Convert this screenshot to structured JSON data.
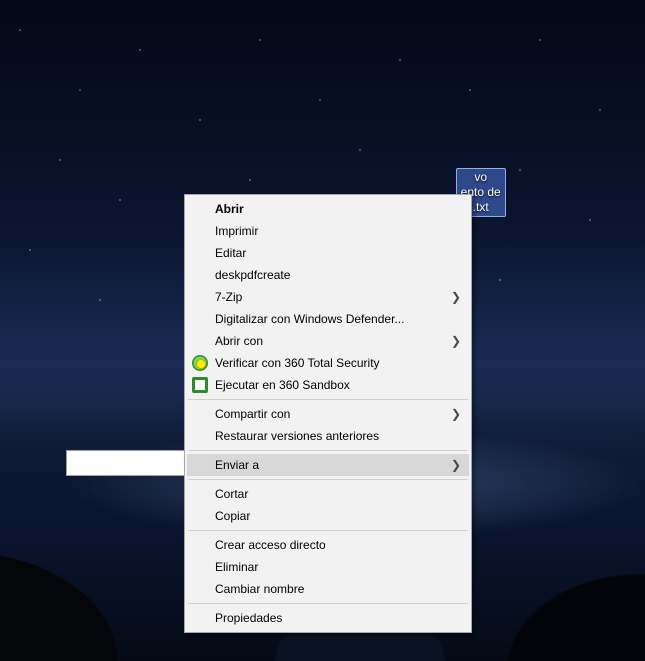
{
  "file": {
    "label": "vo\nento de\n.txt",
    "checked": true
  },
  "menu": {
    "items": [
      {
        "label": "Abrir",
        "bold": true
      },
      {
        "label": "Imprimir"
      },
      {
        "label": "Editar"
      },
      {
        "label": "deskpdfcreate"
      },
      {
        "label": "7-Zip",
        "submenu": true
      },
      {
        "label": "Digitalizar con Windows Defender..."
      },
      {
        "label": "Abrir con",
        "submenu": true
      },
      {
        "label": "Verificar con 360 Total Security",
        "icon": "360-verify"
      },
      {
        "label": "Ejecutar en 360 Sandbox",
        "icon": "360-sandbox"
      },
      {
        "sep": true
      },
      {
        "label": "Compartir con",
        "submenu": true
      },
      {
        "label": "Restaurar versiones anteriores"
      },
      {
        "sep": true
      },
      {
        "label": "Enviar a",
        "submenu": true,
        "highlight": true
      },
      {
        "sep": true
      },
      {
        "label": "Cortar"
      },
      {
        "label": "Copiar"
      },
      {
        "sep": true
      },
      {
        "label": "Crear acceso directo"
      },
      {
        "label": "Eliminar"
      },
      {
        "label": "Cambiar nombre"
      },
      {
        "sep": true
      },
      {
        "label": "Propiedades"
      }
    ]
  }
}
